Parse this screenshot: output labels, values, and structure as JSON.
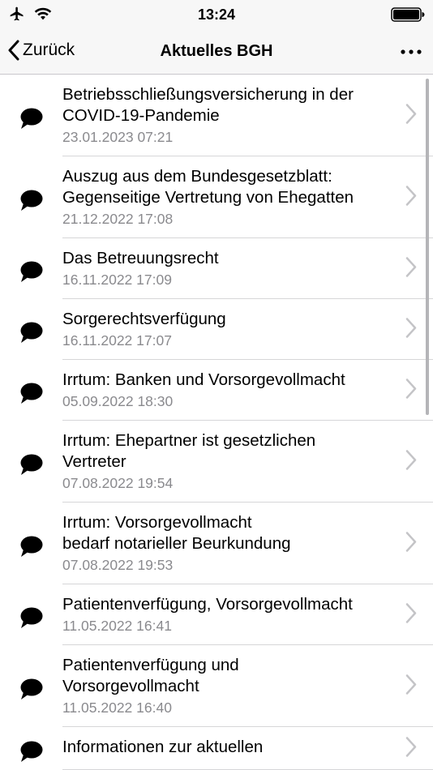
{
  "status": {
    "time": "13:24"
  },
  "nav": {
    "back_label": "Zurück",
    "title": "Aktuelles BGH"
  },
  "items": [
    {
      "title": "Betriebsschließungsversicherung in der\nCOVID-19-Pandemie",
      "date": "23.01.2023 07:21"
    },
    {
      "title": "Auszug aus dem Bundesgesetzblatt:\nGegenseitige Vertretung von Ehegatten",
      "date": "21.12.2022 17:08"
    },
    {
      "title": "Das Betreuungsrecht",
      "date": "16.11.2022 17:09"
    },
    {
      "title": "Sorgerechtsverfügung",
      "date": "16.11.2022 17:07"
    },
    {
      "title": "Irrtum: Banken und Vorsorgevollmacht",
      "date": "05.09.2022 18:30"
    },
    {
      "title": "Irrtum: Ehepartner ist gesetzlichen\nVertreter",
      "date": "07.08.2022 19:54"
    },
    {
      "title": "Irrtum: Vorsorgevollmacht\nbedarf notarieller Beurkundung",
      "date": "07.08.2022 19:53"
    },
    {
      "title": "Patientenverfügung, Vorsorgevollmacht",
      "date": "11.05.2022 16:41"
    },
    {
      "title": "Patientenverfügung und\nVorsorgevollmacht",
      "date": "11.05.2022 16:40"
    },
    {
      "title": "Informationen zur aktuellen",
      "date": ""
    }
  ]
}
